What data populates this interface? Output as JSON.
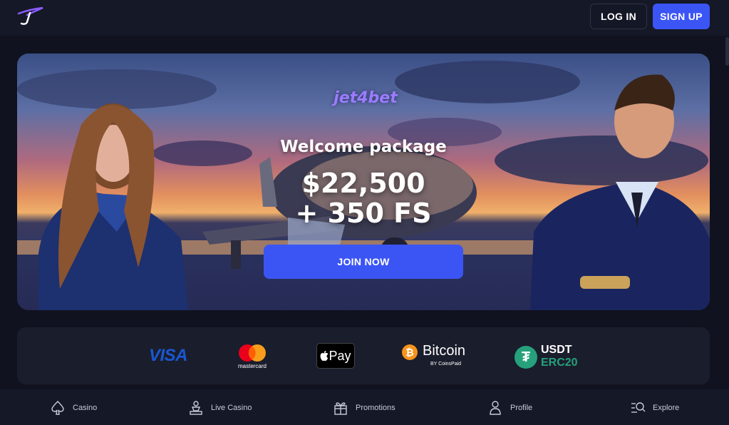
{
  "header": {
    "login_label": "LOG IN",
    "signup_label": "SIGN UP"
  },
  "hero": {
    "brand": "jet4bet",
    "welcome": "Welcome package",
    "amount_line1": "$22,500",
    "amount_line2": "+ 350 FS",
    "cta_label": "JOIN NOW"
  },
  "payments": {
    "visa": "VISA",
    "mastercard": "mastercard",
    "applepay": "Pay",
    "bitcoin": "Bitcoin",
    "bitcoin_sub": "BY CoinsPaid",
    "usdt_line1": "USDT",
    "usdt_line2": "ERC20"
  },
  "bottom_nav": [
    {
      "label": "Casino",
      "icon": "spade-icon"
    },
    {
      "label": "Live Casino",
      "icon": "dealer-icon"
    },
    {
      "label": "Promotions",
      "icon": "gift-icon"
    },
    {
      "label": "Profile",
      "icon": "user-icon"
    },
    {
      "label": "Explore",
      "icon": "search-list-icon"
    }
  ],
  "colors": {
    "accent": "#3b55f5",
    "background": "#10121f",
    "bar": "#151827",
    "bitcoin": "#f7931a",
    "tether": "#26a17b"
  }
}
